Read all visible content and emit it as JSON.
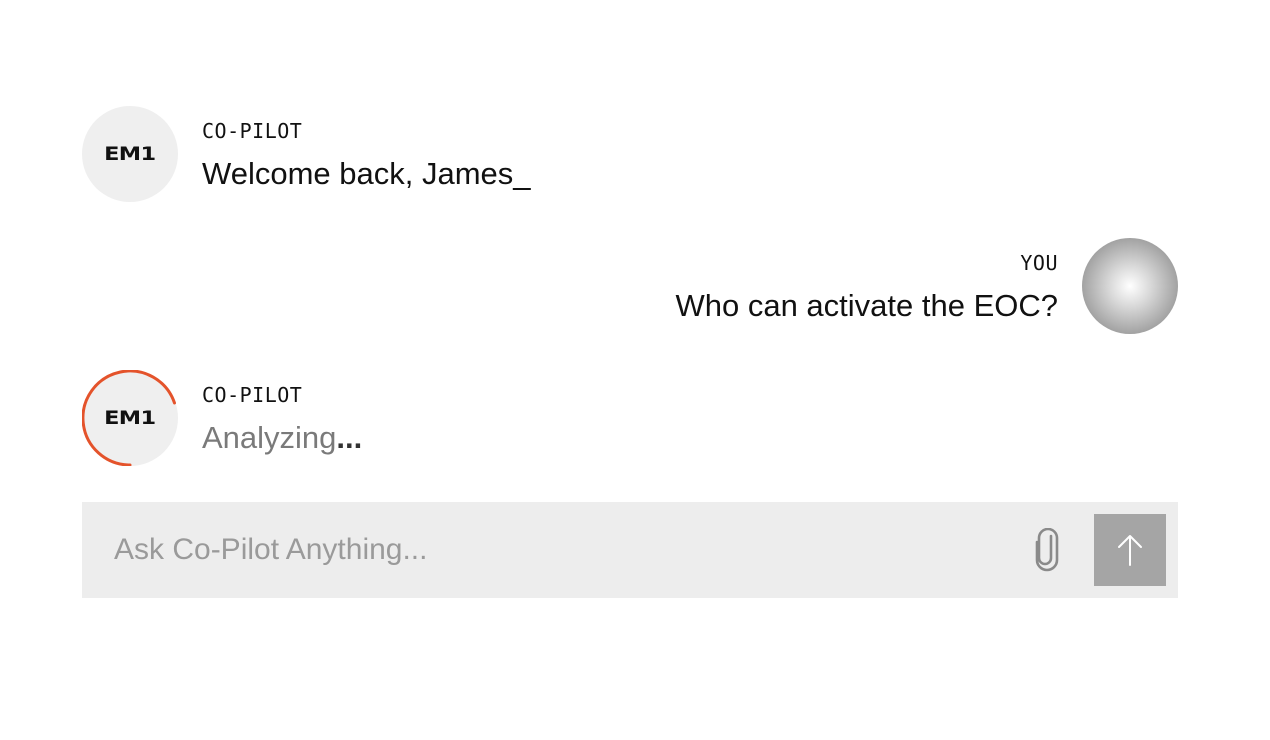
{
  "messages": [
    {
      "sender": "CO-PILOT",
      "text": "Welcome back, James_",
      "avatar_label": "EM1"
    },
    {
      "sender": "YOU",
      "text": "Who can activate the EOC?"
    },
    {
      "sender": "CO-PILOT",
      "text": "Analyzing",
      "suffix": "...",
      "avatar_label": "EM1",
      "status": "loading"
    }
  ],
  "composer": {
    "placeholder": "Ask Co-Pilot Anything...",
    "attach_icon": "paperclip-icon",
    "send_icon": "arrow-up-icon"
  },
  "colors": {
    "loading_ring": "#e4532b",
    "avatar_bg": "#efefef",
    "composer_bg": "#ededed",
    "send_bg": "#a5a5a5"
  }
}
